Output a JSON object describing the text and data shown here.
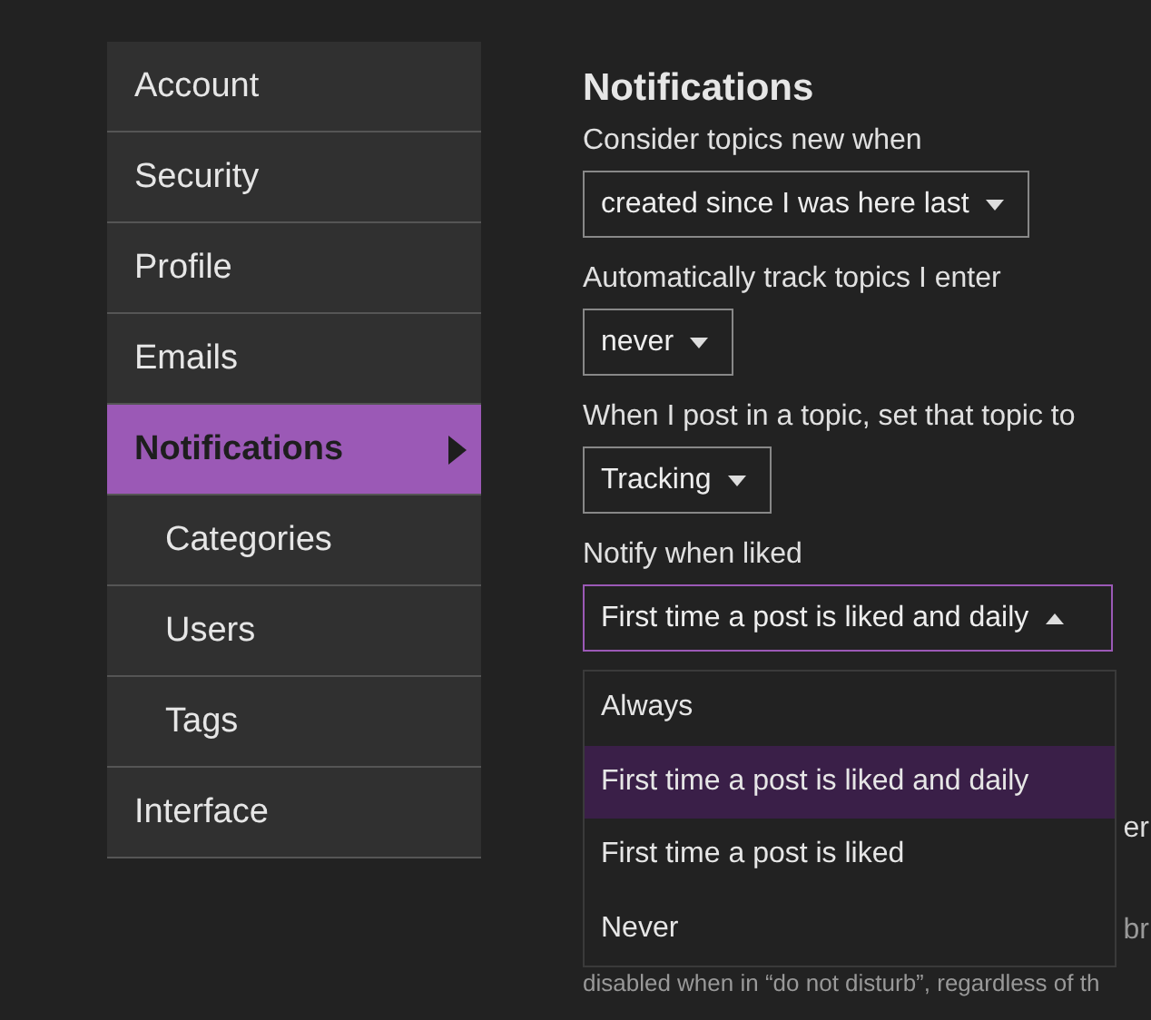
{
  "sidebar": {
    "items": [
      {
        "label": "Account",
        "selected": false
      },
      {
        "label": "Security",
        "selected": false
      },
      {
        "label": "Profile",
        "selected": false
      },
      {
        "label": "Emails",
        "selected": false
      },
      {
        "label": "Notifications",
        "selected": true,
        "children": [
          {
            "label": "Categories",
            "selected": false
          },
          {
            "label": "Users",
            "selected": false
          },
          {
            "label": "Tags",
            "selected": false
          }
        ]
      },
      {
        "label": "Interface",
        "selected": false
      }
    ]
  },
  "content": {
    "title": "Notifications",
    "fields": [
      {
        "label": "Consider topics new when",
        "value": "created since I was here last",
        "expanded": false
      },
      {
        "label": "Automatically track topics I enter",
        "value": "never",
        "expanded": false
      },
      {
        "label": "When I post in a topic, set that topic to",
        "value": "Tracking",
        "expanded": false
      },
      {
        "label": "Notify when liked",
        "value": "First time a post is liked and daily",
        "expanded": true,
        "options": [
          {
            "label": "Always",
            "selected": false
          },
          {
            "label": "First time a post is liked and daily",
            "selected": true
          },
          {
            "label": "First time a post is liked",
            "selected": false
          },
          {
            "label": "Never",
            "selected": false
          }
        ]
      }
    ],
    "covered_texts": [
      "er",
      "br",
      "disabled when in “do not disturb”, regardless of th"
    ]
  }
}
